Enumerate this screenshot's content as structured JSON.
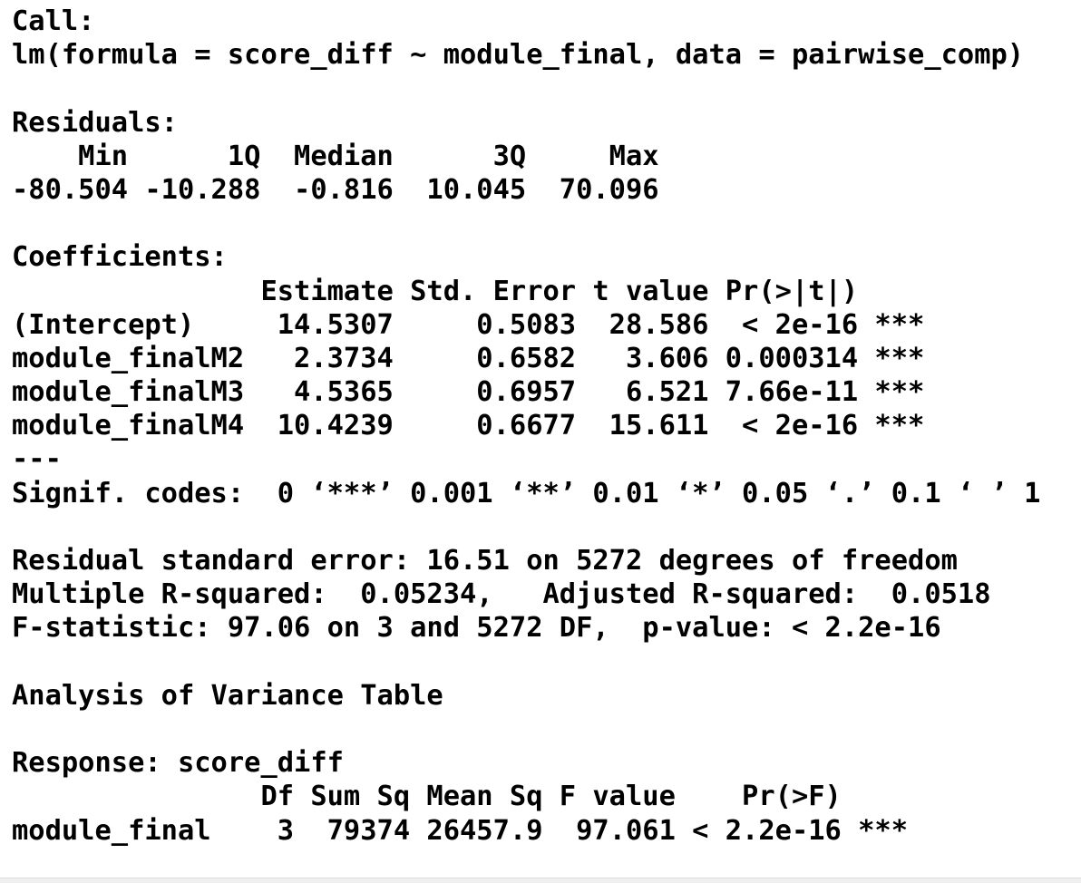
{
  "console": {
    "lines": [
      "Call:",
      "lm(formula = score_diff ~ module_final, data = pairwise_comp)",
      "",
      "Residuals:",
      "    Min      1Q  Median      3Q     Max ",
      "-80.504 -10.288  -0.816  10.045  70.096 ",
      "",
      "Coefficients:",
      "               Estimate Std. Error t value Pr(>|t|)    ",
      "(Intercept)     14.5307     0.5083  28.586  < 2e-16 ***",
      "module_finalM2   2.3734     0.6582   3.606 0.000314 ***",
      "module_finalM3   4.5365     0.6957   6.521 7.66e-11 ***",
      "module_finalM4  10.4239     0.6677  15.611  < 2e-16 ***",
      "---",
      "Signif. codes:  0 ‘***’ 0.001 ‘**’ 0.01 ‘*’ 0.05 ‘.’ 0.1 ‘ ’ 1",
      "",
      "Residual standard error: 16.51 on 5272 degrees of freedom",
      "Multiple R-squared:  0.05234,\tAdjusted R-squared:  0.0518 ",
      "F-statistic: 97.06 on 3 and 5272 DF,  p-value: < 2.2e-16",
      "",
      "Analysis of Variance Table",
      "",
      "Response: score_diff",
      "               Df Sum Sq Mean Sq F value    Pr(>F)    ",
      "module_final    3  79374 26457.9  97.061 < 2.2e-16 ***"
    ]
  }
}
